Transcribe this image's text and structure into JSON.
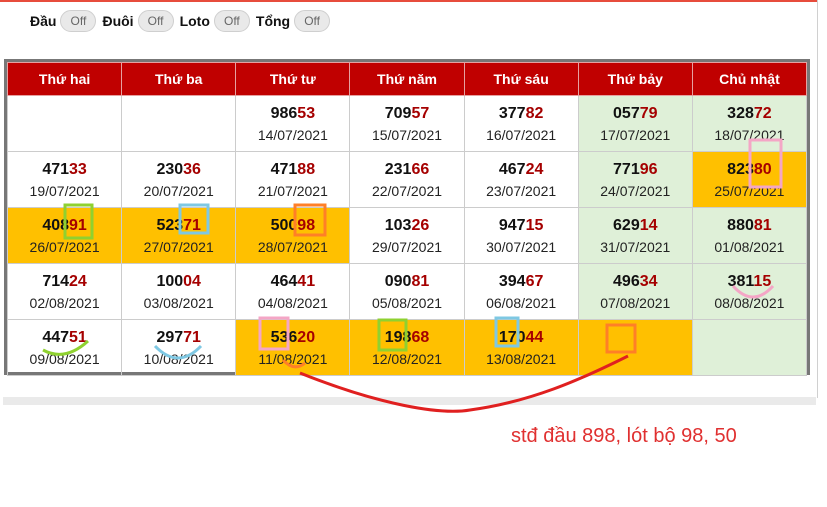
{
  "toggles": [
    {
      "label": "Đầu",
      "value": "Off"
    },
    {
      "label": "Đuôi",
      "value": "Off"
    },
    {
      "label": "Loto",
      "value": "Off"
    },
    {
      "label": "Tổng",
      "value": "Off"
    }
  ],
  "calendar": {
    "headers": [
      "Thứ hai",
      "Thứ ba",
      "Thứ tư",
      "Thứ năm",
      "Thứ sáu",
      "Thứ bảy",
      "Chủ nhật"
    ],
    "rows": [
      [
        {
          "empty": true
        },
        {
          "empty": true
        },
        {
          "head": "986",
          "tail": "53",
          "date": "14/07/2021"
        },
        {
          "head": "709",
          "tail": "57",
          "date": "15/07/2021"
        },
        {
          "head": "377",
          "tail": "82",
          "date": "16/07/2021"
        },
        {
          "head": "057",
          "tail": "79",
          "date": "17/07/2021",
          "bg": "g"
        },
        {
          "head": "328",
          "tail": "72",
          "date": "18/07/2021",
          "bg": "g"
        }
      ],
      [
        {
          "head": "471",
          "tail": "33",
          "date": "19/07/2021"
        },
        {
          "head": "230",
          "tail": "36",
          "date": "20/07/2021"
        },
        {
          "head": "471",
          "tail": "88",
          "date": "21/07/2021"
        },
        {
          "head": "231",
          "tail": "66",
          "date": "22/07/2021"
        },
        {
          "head": "467",
          "tail": "24",
          "date": "23/07/2021"
        },
        {
          "head": "771",
          "tail": "96",
          "date": "24/07/2021",
          "bg": "g"
        },
        {
          "head": "823",
          "tail": "80",
          "date": "25/07/2021",
          "bg": "o"
        }
      ],
      [
        {
          "head": "408",
          "tail": "91",
          "date": "26/07/2021",
          "bg": "o"
        },
        {
          "head": "523",
          "tail": "71",
          "date": "27/07/2021",
          "bg": "o"
        },
        {
          "head": "500",
          "tail": "98",
          "date": "28/07/2021",
          "bg": "o"
        },
        {
          "head": "103",
          "tail": "26",
          "date": "29/07/2021"
        },
        {
          "head": "947",
          "tail": "15",
          "date": "30/07/2021"
        },
        {
          "head": "629",
          "tail": "14",
          "date": "31/07/2021",
          "bg": "g"
        },
        {
          "head": "880",
          "tail": "81",
          "date": "01/08/2021",
          "bg": "g"
        }
      ],
      [
        {
          "head": "714",
          "tail": "24",
          "date": "02/08/2021"
        },
        {
          "head": "100",
          "tail": "04",
          "date": "03/08/2021"
        },
        {
          "head": "464",
          "tail": "41",
          "date": "04/08/2021"
        },
        {
          "head": "090",
          "tail": "81",
          "date": "05/08/2021"
        },
        {
          "head": "394",
          "tail": "67",
          "date": "06/08/2021"
        },
        {
          "head": "496",
          "tail": "34",
          "date": "07/08/2021",
          "bg": "g"
        },
        {
          "head": "381",
          "tail": "15",
          "date": "08/08/2021",
          "bg": "g"
        }
      ],
      [
        {
          "head": "447",
          "tail": "51",
          "date": "09/08/2021"
        },
        {
          "head": "297",
          "tail": "71",
          "date": "10/08/2021"
        },
        {
          "head": "536",
          "tail": "20",
          "date": "11/08/2021",
          "bg": "o"
        },
        {
          "head": "198",
          "tail": "68",
          "date": "12/08/2021",
          "bg": "o"
        },
        {
          "head": "170",
          "tail": "44",
          "date": "13/08/2021",
          "bg": "o"
        },
        {
          "empty": true,
          "bg": "o"
        },
        {
          "empty": true,
          "bg": "g"
        }
      ]
    ]
  },
  "annotation_text": "stđ đầu 898, lót bộ 98, 50",
  "colors": {
    "header_bg": "#c00000",
    "highlight_orange": "#ffc000",
    "weekend_green": "#dff0d8",
    "tail_digits": "#a50000",
    "annotation_red": "#e03030"
  }
}
